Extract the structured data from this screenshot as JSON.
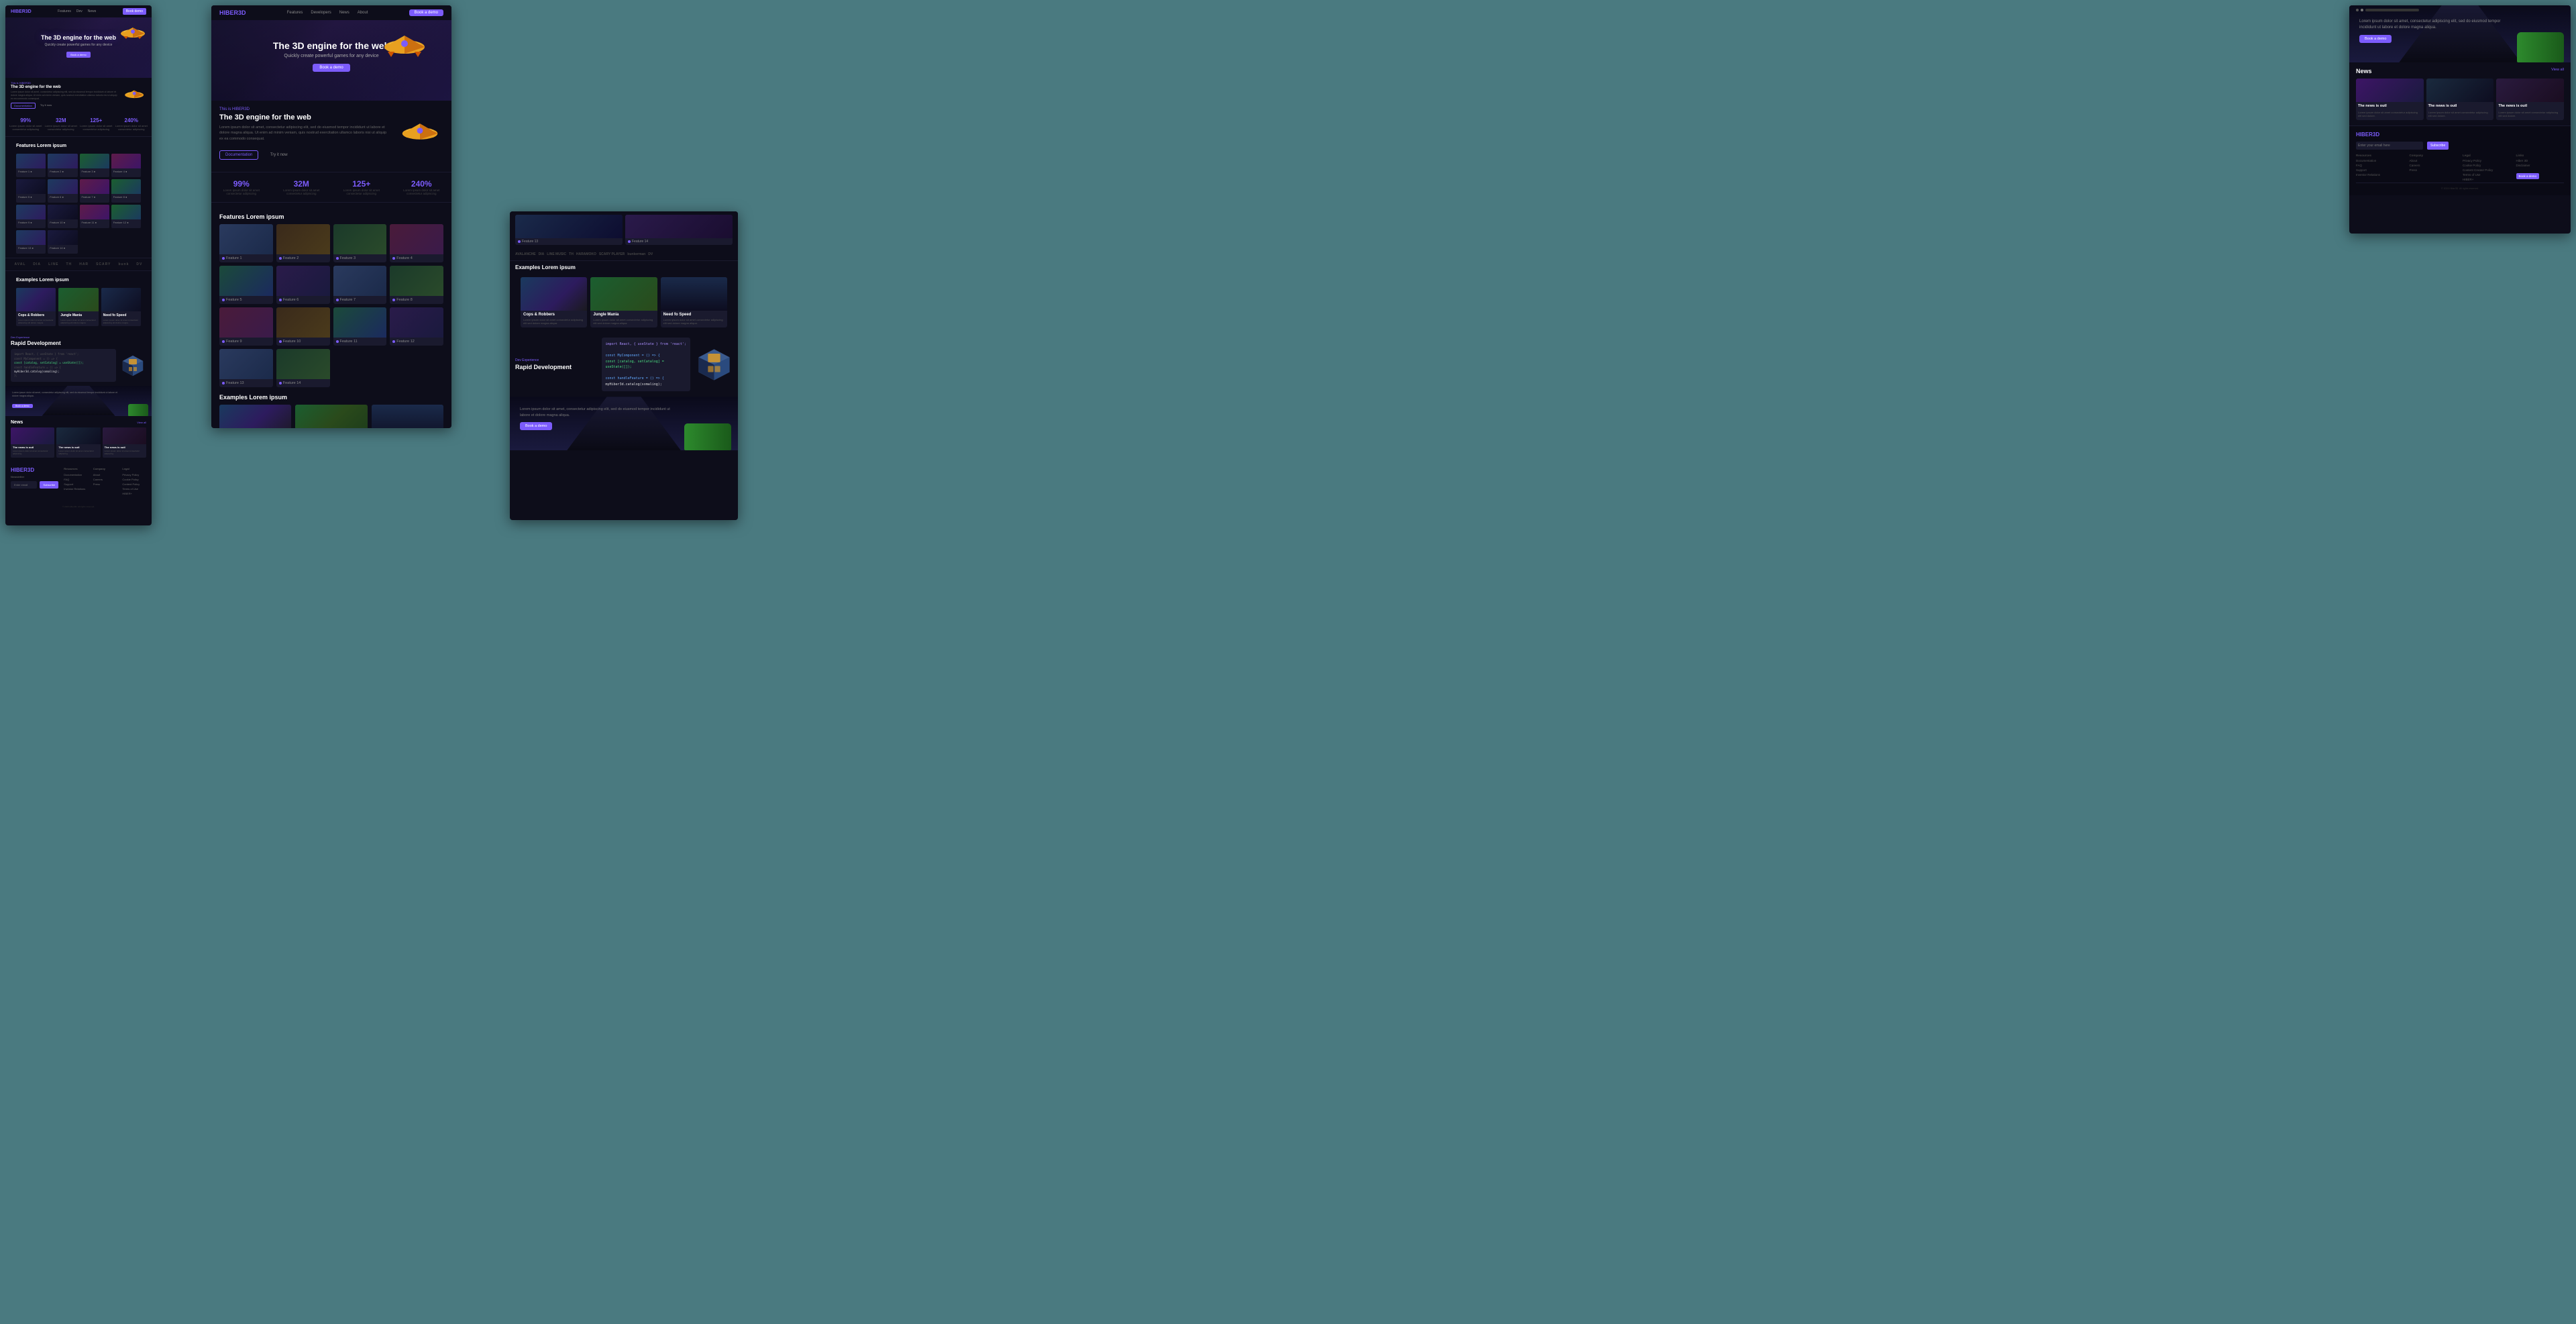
{
  "page": {
    "background": "#4a7a80"
  },
  "nav": {
    "logo": "HIBER3D",
    "links": [
      "Features",
      "Developers",
      "News",
      "About"
    ],
    "cta": "Book a demo"
  },
  "hero": {
    "title": "The 3D engine for the web",
    "subtitle": "Quickly create powerful games for any device",
    "cta": "Book a demo"
  },
  "feature_intro": {
    "tag": "This is HIBER3D",
    "title": "The 3D engine for the web",
    "body": "Lorem ipsum dolor sit amet, consectetur adipiscing elit, sed do eiusmod tempor incididunt ut labore et dolore magna aliqua. Ut enim ad minim veniam, quis nostrud exercitation ullamco laboris nisi ut aliquip ex ea commodo consequat.",
    "btn_primary": "Documentation",
    "btn_secondary": "Try it now"
  },
  "stats": [
    {
      "value": "99%",
      "label": "Lorem ipsum dolor sit amet consectetur adipiscing"
    },
    {
      "value": "32M",
      "label": "Lorem ipsum dolor sit amet consectetur adipiscing"
    },
    {
      "value": "125+",
      "label": "Lorem ipsum dolor sit amet consectetur adipiscing"
    },
    {
      "value": "240%",
      "label": "Lorem ipsum dolor sit amet consectetur adipiscing"
    }
  ],
  "features": {
    "section_title": "Features Lorem ipsum",
    "items": [
      {
        "label": "Feature 1",
        "variant": "v1"
      },
      {
        "label": "Feature 2",
        "variant": "v2"
      },
      {
        "label": "Feature 3",
        "variant": "v3"
      },
      {
        "label": "Feature 4",
        "variant": "v4"
      },
      {
        "label": "Feature 5",
        "variant": "v1"
      },
      {
        "label": "Feature 6",
        "variant": "v5"
      },
      {
        "label": "Feature 7",
        "variant": "v3"
      },
      {
        "label": "Feature 8",
        "variant": "v6"
      },
      {
        "label": "Feature 9",
        "variant": "v2"
      },
      {
        "label": "Feature 10",
        "variant": "v4"
      },
      {
        "label": "Feature 11",
        "variant": "v1"
      },
      {
        "label": "Feature 12",
        "variant": "v5"
      },
      {
        "label": "Feature 13",
        "variant": "v6"
      },
      {
        "label": "Feature 14",
        "variant": "v3"
      }
    ]
  },
  "examples": {
    "section_title": "Examples Lorem ipsum",
    "items": [
      {
        "title": "Cops & Robbers",
        "desc": "Lorem ipsum dolor sit amet consectetur adipiscing elit sed do eiusmod dolore magna aliqua.",
        "variant": "cops"
      },
      {
        "title": "Jungle Mania",
        "desc": "Lorem ipsum dolor sit amet consectetur adipiscing elit sed do eiusmod dolore magna aliqua.",
        "variant": "jungle"
      },
      {
        "title": "Need fo Speed",
        "desc": "Lorem ipsum dolor sit amet consectetur adipiscing elit sed do eiusmod dolore magna aliqua.",
        "variant": "speed"
      }
    ]
  },
  "dev_experience": {
    "tag": "Dev Experience",
    "title": "Rapid Development",
    "code_lines": [
      {
        "text": "import React, { useState } from 'react';",
        "class": "c-purple"
      },
      {
        "text": "",
        "class": "c-gray"
      },
      {
        "text": "const MyComponent = () => {",
        "class": "c-blue"
      },
      {
        "text": "  const [catalog, setCatalog] = useState([]);",
        "class": "c-green"
      },
      {
        "text": "",
        "class": "c-gray"
      },
      {
        "text": "  const handleFeature = () => {",
        "class": "c-blue"
      },
      {
        "text": "    myHiber3d.catalog(somaling);",
        "class": "c-white"
      },
      {
        "text": "  };",
        "class": "c-gray"
      }
    ]
  },
  "road_section": {
    "desc": "Lorem ipsum dolor sit amet, consectetur adipiscing elit, sed do eiusmod tempor incididunt ut labore et dolore magna aliqua.",
    "cta": "Book a demo"
  },
  "partners": [
    "AVALANCHE",
    "DIA",
    "LINE MUSIC",
    "Tommy Hilfiger",
    "HARAMOKO",
    "SCARY PLAYER",
    "bunkerman",
    "DV"
  ],
  "news": {
    "title": "News",
    "view_all": "View all",
    "items": [
      {
        "title": "The news is outl",
        "desc": "Lorem ipsum dolor sit amet consectetur adipiscing elit sed do eiusmod dolore.",
        "variant": "n1"
      },
      {
        "title": "The news is outl",
        "desc": "Lorem ipsum dolor sit amet consectetur adipiscing elit sed do eiusmod dolore.",
        "variant": "n2"
      },
      {
        "title": "The news is outl",
        "desc": "Lorem ipsum dolor sit amet consectetur adipiscing elit sed do eiusmod dolore.",
        "variant": "n3"
      }
    ]
  },
  "footer": {
    "logo": "HIBER3D",
    "newsletter_label": "Newsletter",
    "newsletter_placeholder": "Enter your email here",
    "subscribe_label": "Subscribe",
    "cols": [
      {
        "title": "Resources",
        "links": [
          "Documentation",
          "FAQ",
          "Support",
          "Investor Relations"
        ]
      },
      {
        "title": "Company",
        "links": [
          "About",
          "Careers",
          "Press"
        ]
      },
      {
        "title": "Legal",
        "links": [
          "Privacy Policy",
          "Cookie Policy",
          "Content Creator Policy",
          "Terms of Use",
          "HIBER+"
        ]
      }
    ],
    "copyright": "© 2024 Hiber3D. All rights reserved."
  }
}
